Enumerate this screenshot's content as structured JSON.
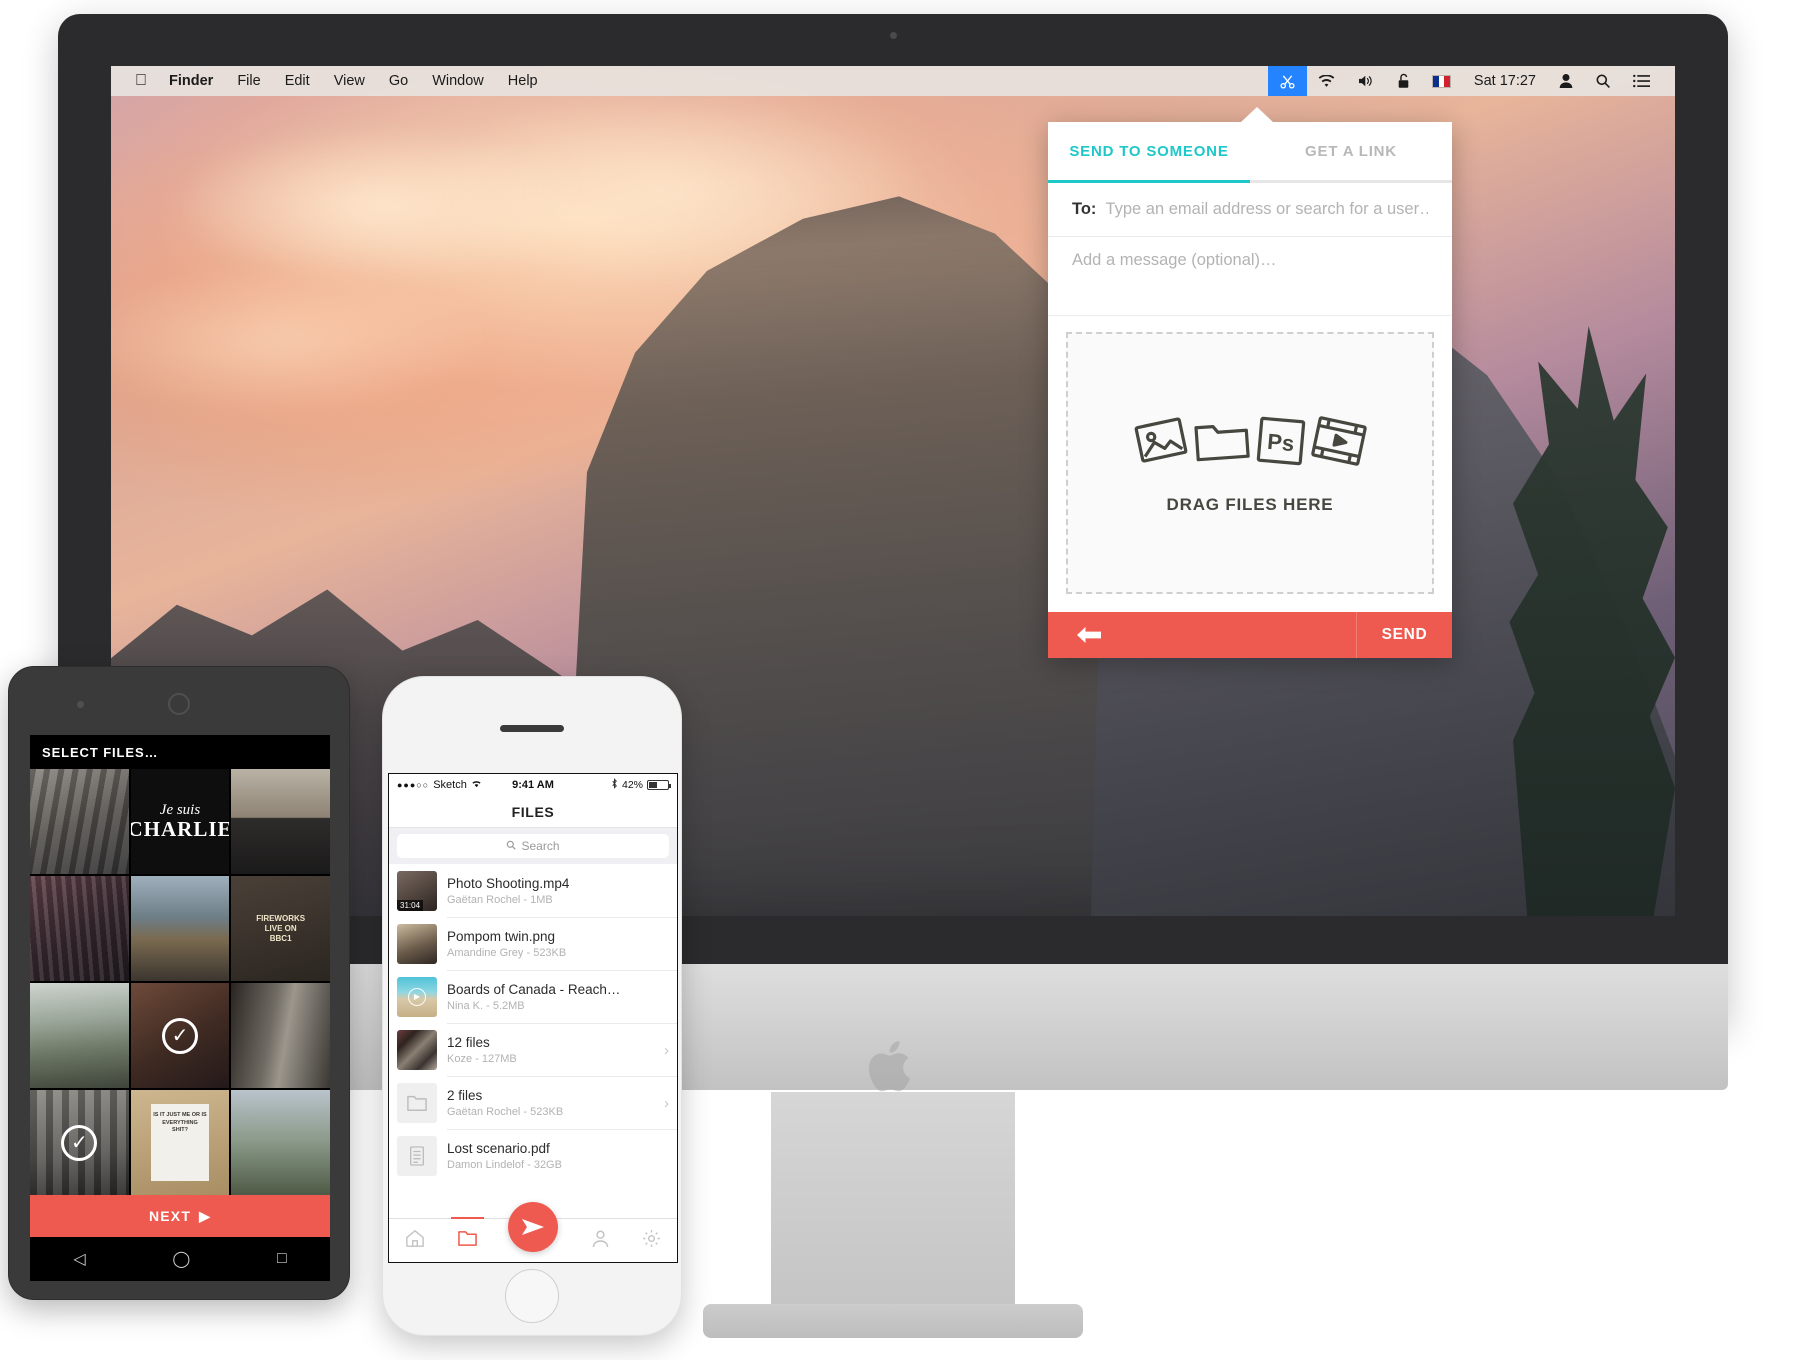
{
  "desktop": {
    "menubar": {
      "apple_icon": "apple-icon",
      "items": [
        {
          "label": "Finder",
          "bold": true
        },
        {
          "label": "File",
          "bold": false
        },
        {
          "label": "Edit",
          "bold": false
        },
        {
          "label": "View",
          "bold": false
        },
        {
          "label": "Go",
          "bold": false
        },
        {
          "label": "Window",
          "bold": false
        },
        {
          "label": "Help",
          "bold": false
        }
      ],
      "status_icons": [
        "scissors-icon",
        "wifi-icon",
        "volume-icon",
        "lock-icon",
        "french-flag-icon"
      ],
      "clock": "Sat 17:27",
      "trailing_icons": [
        "user-icon",
        "search-icon",
        "list-icon"
      ],
      "active_icon_color": "#2484ff"
    }
  },
  "popup": {
    "tabs": [
      {
        "label": "SEND TO SOMEONE",
        "active": true
      },
      {
        "label": "GET A LINK",
        "active": false
      }
    ],
    "accent_color": "#1ec8c8",
    "to": {
      "label": "To:",
      "placeholder": "Type an email address or search for a user…",
      "value": ""
    },
    "message": {
      "placeholder": "Add a message (optional)…",
      "value": ""
    },
    "dropzone": {
      "label": "DRAG FILES HERE",
      "icons": [
        "image-icon",
        "folder-icon",
        "photoshop-icon",
        "video-icon"
      ],
      "photoshop_label": "Ps"
    },
    "actionbar": {
      "back_icon": "back-arrow-icon",
      "send_label": "SEND",
      "color": "#ee5a4f"
    }
  },
  "android": {
    "header": "SELECT FILES…",
    "next_label": "NEXT",
    "next_icon": "play-icon",
    "accent_color": "#ee5a4f",
    "grid": [
      {
        "name": "street-photo",
        "selected": false
      },
      {
        "name": "je-suis-charlie",
        "selected": false,
        "line1": "Je suis",
        "line2": "CHARLIE"
      },
      {
        "name": "houses-photo",
        "selected": false
      },
      {
        "name": "crowd-photo",
        "selected": false
      },
      {
        "name": "canal-photo",
        "selected": false
      },
      {
        "name": "fireworks-photo",
        "selected": false,
        "line1": "FIREWORKS",
        "line2": "LIVE ON",
        "line3": "BBC1"
      },
      {
        "name": "sunset-photo",
        "selected": false
      },
      {
        "name": "portrait-photo",
        "selected": true
      },
      {
        "name": "alley-photo",
        "selected": false
      },
      {
        "name": "building-photo",
        "selected": true
      },
      {
        "name": "poster-photo",
        "selected": false,
        "line1": "IS IT JUST ME OR IS",
        "line2": "EVERYTHING",
        "line3": "SHIT?"
      },
      {
        "name": "park-photo",
        "selected": false
      }
    ],
    "navbar_icons": [
      "back-icon",
      "home-icon",
      "recents-icon"
    ]
  },
  "iphone": {
    "status": {
      "signal": "●●●○○",
      "carrier": "Sketch",
      "wifi_icon": "wifi-icon",
      "time": "9:41 AM",
      "bluetooth_icon": "bluetooth-icon",
      "battery": "42%"
    },
    "navbar_title": "FILES",
    "search_placeholder": "Search",
    "search_icon": "search-icon",
    "files": [
      {
        "name": "Photo Shooting.mp4",
        "sub": "Gaëtan Rochel - 1MB",
        "thumb": "video-thumb",
        "duration": "31:04",
        "chevron": false
      },
      {
        "name": "Pompom twin.png",
        "sub": "Amandine Grey - 523KB",
        "thumb": "image-thumb",
        "duration": "",
        "chevron": false
      },
      {
        "name": "Boards of Canada - Reach…",
        "sub": "Nina K. - 5.2MB",
        "thumb": "audio-thumb",
        "duration": "",
        "chevron": false
      },
      {
        "name": "12 files",
        "sub": "Koze - 127MB",
        "thumb": "collage-thumb",
        "duration": "",
        "chevron": true
      },
      {
        "name": "2 files",
        "sub": "Gaëtan Rochel - 523KB",
        "thumb": "folder-thumb",
        "duration": "",
        "chevron": true
      },
      {
        "name": "Lost scenario.pdf",
        "sub": "Damon Lindelof - 32GB",
        "thumb": "document-thumb",
        "duration": "",
        "chevron": false
      }
    ],
    "tabbar": [
      {
        "icon": "home-icon",
        "active": false
      },
      {
        "icon": "folder-icon",
        "active": true
      },
      {
        "icon": "send-icon",
        "active": false,
        "fab": true
      },
      {
        "icon": "person-icon",
        "active": false
      },
      {
        "icon": "gear-icon",
        "active": false
      }
    ],
    "accent_color": "#ee5a4f"
  }
}
